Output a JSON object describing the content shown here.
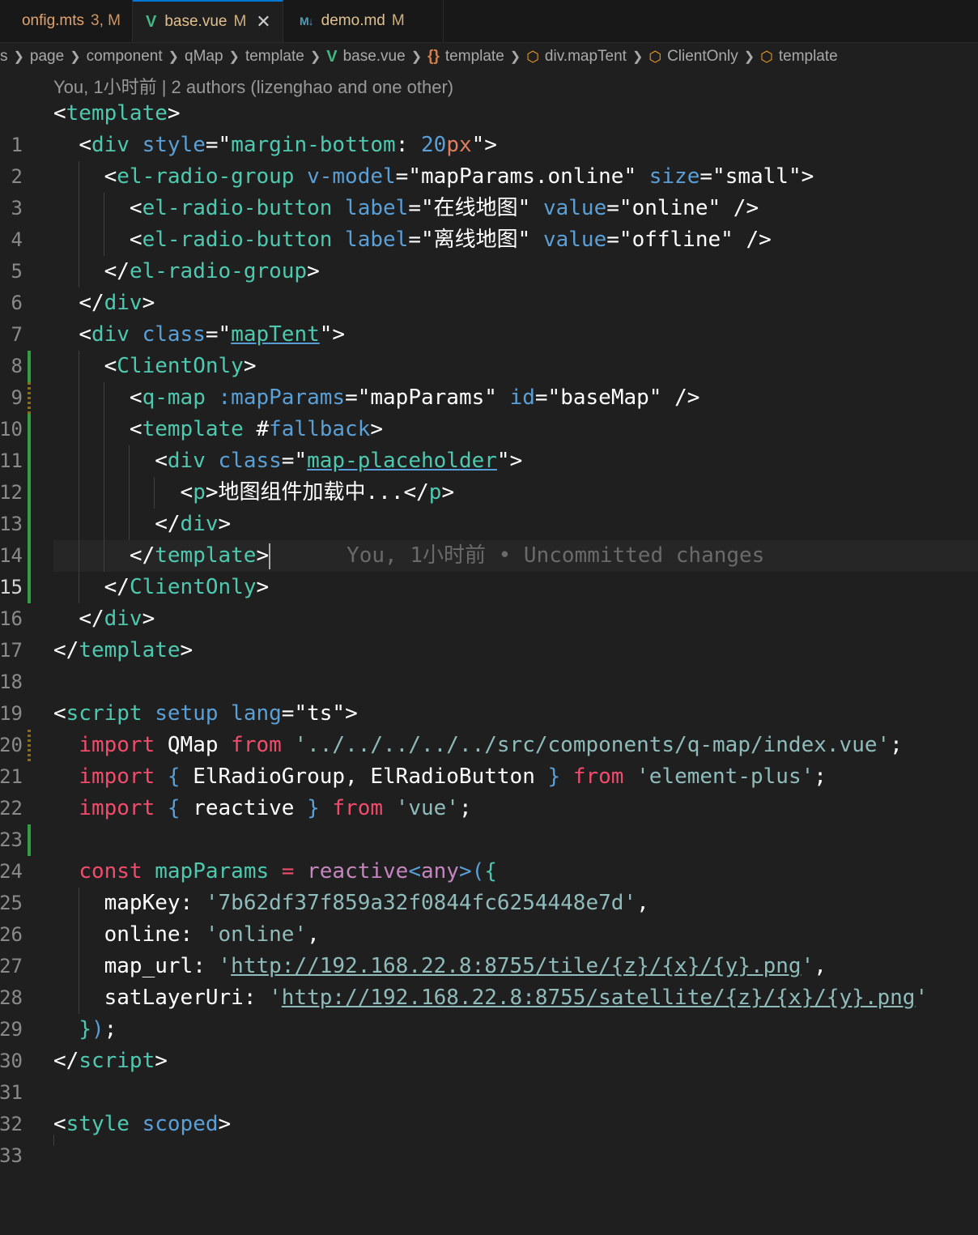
{
  "tabs": [
    {
      "name": "onfig.mts",
      "status": "3, M"
    },
    {
      "name": "base.vue",
      "status": "M",
      "close": "✕",
      "icon": "V"
    },
    {
      "name": "demo.md",
      "status": "M",
      "icon": "M↓"
    }
  ],
  "breadcrumb": {
    "items": [
      "s",
      "page",
      "component",
      "qMap",
      "template",
      "base.vue",
      "template",
      "div.mapTent",
      "ClientOnly",
      "template"
    ]
  },
  "blame_header": "You, 1小时前 | 2 authors (lizenghao and one other)",
  "ghost_blame": "You, 1小时前 • Uncommitted changes",
  "line_numbers": [
    "1",
    "2",
    "3",
    "4",
    "5",
    "6",
    "7",
    "8",
    "9",
    "10",
    "11",
    "12",
    "13",
    "14",
    "15",
    "16",
    "17",
    "18",
    "19",
    "20",
    "21",
    "22",
    "23",
    "24",
    "25",
    "26",
    "27",
    "28",
    "29",
    "30",
    "31",
    "32",
    "33"
  ],
  "code": {
    "l2_style": "margin-bottom: 20px",
    "l3_vmodel": "mapParams.online",
    "l3_size": "small",
    "l4_label": "在线地图",
    "l4_value": "online",
    "l5_label": "离线地图",
    "l5_value": "offline",
    "l8_class": "mapTent",
    "l10_bind": "mapParams",
    "l10_id": "baseMap",
    "l12_class": "map-placeholder",
    "l13_text": "地图组件加载中...",
    "l20_lang": "ts",
    "l21_path": "'../../../../../src/components/q-map/index.vue'",
    "l22_pkg": "'element-plus'",
    "l23_pkg": "'vue'",
    "l26_key": "'7b62df37f859a32f0844fc6254448e7d'",
    "l27_online": "'online'",
    "l28_url": "http://192.168.22.8:8755/tile/{z}/{x}/{y}.png",
    "l29_url": "http://192.168.22.8:8755/satellite/{z}/{x}/{y}.png"
  }
}
